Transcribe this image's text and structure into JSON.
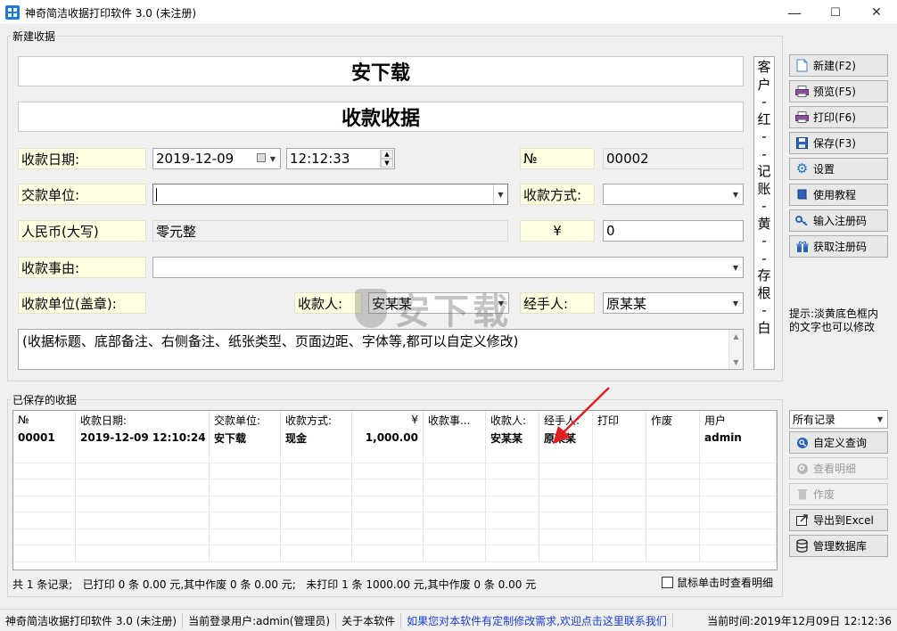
{
  "window": {
    "title": "神奇简洁收据打印软件 3.0 (未注册)",
    "minimize": "—",
    "maximize": "☐",
    "close": "✕"
  },
  "new_receipt": {
    "group_label": "新建收据",
    "company": "安下载",
    "receipt_title": "收款收据",
    "date_label": "收款日期:",
    "date_value": "2019-12-09",
    "time_value": "12:12:33",
    "no_label": "№",
    "no_value": "00002",
    "payer_label": "交款单位:",
    "payer_value": "",
    "method_label": "收款方式:",
    "method_value": "",
    "rmb_upper_label": "人民币(大写)",
    "rmb_upper_value": "零元整",
    "yen_label": "¥",
    "amount_value": "0",
    "reason_label": "收款事由:",
    "reason_value": "",
    "stamp_label": "收款单位(盖章):",
    "receiver_label": "收款人:",
    "receiver_value": "安某某",
    "handler_label": "经手人:",
    "handler_value": "原某某",
    "notes": "(收据标题、底部备注、右侧备注、纸张类型、页面边距、字体等,都可以自定义修改)",
    "side_strip": [
      "客",
      "户",
      "-",
      "红",
      "-",
      "-",
      "记",
      "账",
      "-",
      "黄",
      "-",
      "-",
      "存",
      "根",
      "-",
      "白"
    ]
  },
  "buttons": {
    "new": "新建(F2)",
    "preview": "预览(F5)",
    "print": "打印(F6)",
    "save": "保存(F3)",
    "settings": "设置",
    "tutorial": "使用教程",
    "enter_code": "输入注册码",
    "get_code": "获取注册码",
    "custom_query": "自定义查询",
    "view_detail": "查看明细",
    "void": "作废",
    "export_excel": "导出到Excel",
    "manage_db": "管理数据库"
  },
  "hint": "提示:淡黄底色框内的文字也可以修改",
  "saved": {
    "group_label": "已保存的收据",
    "filter_value": "所有记录",
    "columns": [
      "№",
      "收款日期:",
      "交款单位:",
      "收款方式:",
      "¥",
      "收款事...",
      "收款人:",
      "经手人:",
      "打印",
      "作废",
      "用户"
    ],
    "rows": [
      [
        "00001",
        "2019-12-09 12:10:24",
        "安下载",
        "现金",
        "1,000.00",
        "",
        "安某某",
        "原某某",
        "",
        "",
        "admin"
      ]
    ],
    "summary": "共 1 条记录;   已打印 0 条 0.00 元,其中作废 0 条 0.00 元;   未打印 1 条 1000.00 元,其中作废 0 条 0.00 元",
    "click_detail_label": "鼠标单击时查看明细"
  },
  "statusbar": {
    "app": "神奇简洁收据打印软件 3.0 (未注册)",
    "user": "当前登录用户:admin(管理员)",
    "about": "关于本软件",
    "contact": "如果您对本软件有定制修改需求,欢迎点击这里联系我们",
    "time": "当前时间:2019年12月09日 12:12:36"
  },
  "colors": {
    "label_bg": "#ffffe1",
    "link": "#1a3ecc",
    "arrow": "#e02020"
  },
  "icons": {
    "new": "new-document-icon",
    "preview": "printer-preview-icon",
    "print": "printer-icon",
    "save": "floppy-disk-icon",
    "settings": "gear-icon",
    "tutorial": "book-icon",
    "enter_code": "key-icon",
    "get_code": "gift-icon",
    "custom_query": "search-icon",
    "view_detail": "magnifier-icon",
    "void": "trash-icon",
    "export_excel": "export-icon",
    "manage_db": "database-icon"
  }
}
